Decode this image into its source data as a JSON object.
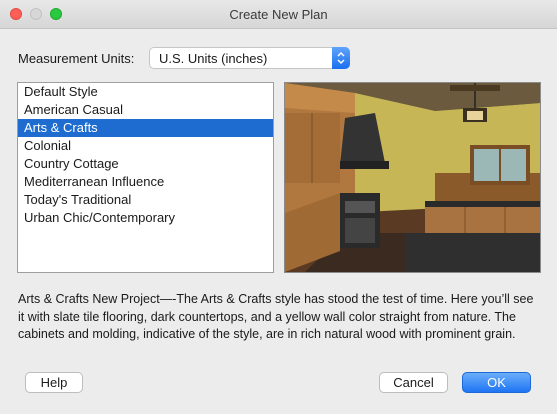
{
  "window": {
    "title": "Create New Plan"
  },
  "units": {
    "label": "Measurement Units:",
    "value": "U.S. Units (inches)"
  },
  "styles": [
    {
      "label": "Default Style",
      "selected": false
    },
    {
      "label": "American Casual",
      "selected": false
    },
    {
      "label": "Arts & Crafts",
      "selected": true
    },
    {
      "label": "Colonial",
      "selected": false
    },
    {
      "label": "Country Cottage",
      "selected": false
    },
    {
      "label": "Mediterranean Influence",
      "selected": false
    },
    {
      "label": "Today's Traditional",
      "selected": false
    },
    {
      "label": "Urban Chic/Contemporary",
      "selected": false
    }
  ],
  "description": "Arts & Crafts New Project—-The Arts & Crafts style has stood the test of time. Here you’ll see it with slate tile flooring, dark countertops, and a yellow wall color straight from nature. The cabinets and molding, indicative of the style, are in rich natural wood with prominent grain.",
  "buttons": {
    "help": "Help",
    "cancel": "Cancel",
    "ok": "OK"
  },
  "colors": {
    "selection": "#1f6cd1",
    "accent": "#1f75f3",
    "wall": "#c9b85a",
    "wood": "#a06e3c"
  }
}
